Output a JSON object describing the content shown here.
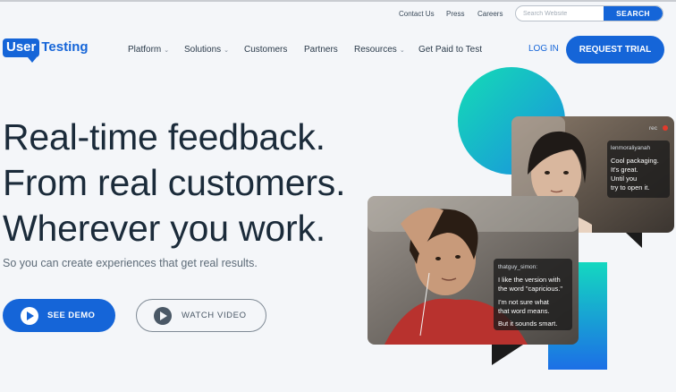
{
  "topbar": {
    "links": [
      "Contact Us",
      "Press",
      "Careers"
    ],
    "search_placeholder": "Search Website",
    "search_button": "SEARCH"
  },
  "brand": {
    "part1": "User",
    "part2": "Testing"
  },
  "nav": {
    "items": [
      {
        "label": "Platform",
        "dropdown": true
      },
      {
        "label": "Solutions",
        "dropdown": true
      },
      {
        "label": "Customers",
        "dropdown": false
      },
      {
        "label": "Partners",
        "dropdown": false
      },
      {
        "label": "Resources",
        "dropdown": true
      },
      {
        "label": "Get Paid to Test",
        "dropdown": false
      }
    ],
    "login": "LOG IN",
    "cta": "REQUEST TRIAL"
  },
  "hero": {
    "line1": "Real-time feedback.",
    "line2": "From real customers.",
    "line3": "Wherever you work.",
    "subtitle": "So you can create experiences that get real results.",
    "demo_button": "SEE DEMO",
    "video_button": "WATCH VIDEO"
  },
  "card_top": {
    "user": "lenmoraliyanah",
    "recording": "rec",
    "caption_lines": [
      "Cool packaging.",
      "It's great.",
      "Until you",
      "try to open it."
    ]
  },
  "card_bottom": {
    "user": "thatguy_simon:",
    "caption_lines": [
      "I like the version with",
      "the word \"capricious.\"",
      "",
      "I'm not sure what",
      "that word means.",
      "",
      "But it sounds smart."
    ]
  },
  "colors": {
    "brand_blue": "#1565d8",
    "teal": "#19d3b8",
    "text": "#1b2b3a"
  }
}
